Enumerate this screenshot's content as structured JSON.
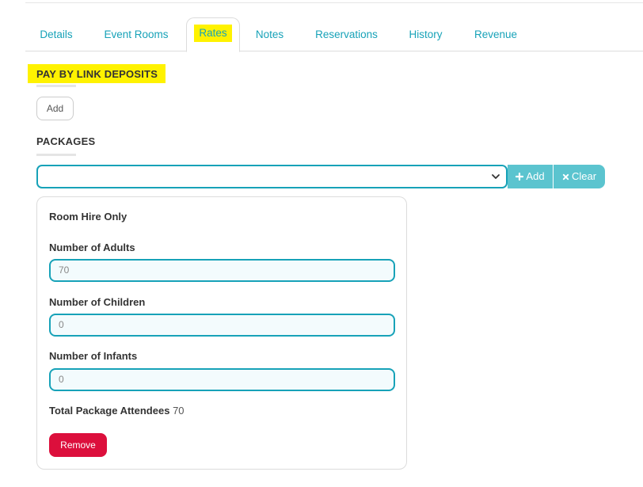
{
  "tabs": [
    {
      "label": "Details",
      "active": false
    },
    {
      "label": "Event Rooms",
      "active": false
    },
    {
      "label": "Rates",
      "active": true
    },
    {
      "label": "Notes",
      "active": false
    },
    {
      "label": "Reservations",
      "active": false
    },
    {
      "label": "History",
      "active": false
    },
    {
      "label": "Revenue",
      "active": false
    }
  ],
  "deposits": {
    "title": "PAY BY LINK DEPOSITS",
    "add_label": "Add"
  },
  "packages": {
    "title": "PACKAGES",
    "select_value": "",
    "add_label": "Add",
    "clear_label": "Clear",
    "add_icon": "plus-icon",
    "clear_icon": "x-icon"
  },
  "package_card": {
    "name": "Room Hire Only",
    "adults_label": "Number of Adults",
    "adults_value": "70",
    "children_label": "Number of Children",
    "children_value": "0",
    "infants_label": "Number of Infants",
    "infants_value": "0",
    "total_label": "Total Package Attendees",
    "total_value": "70",
    "remove_label": "Remove"
  },
  "colors": {
    "accent": "#17a2b8",
    "button_teal": "#5bc4cf",
    "highlight": "#fff200",
    "danger": "#dc0f3c"
  }
}
